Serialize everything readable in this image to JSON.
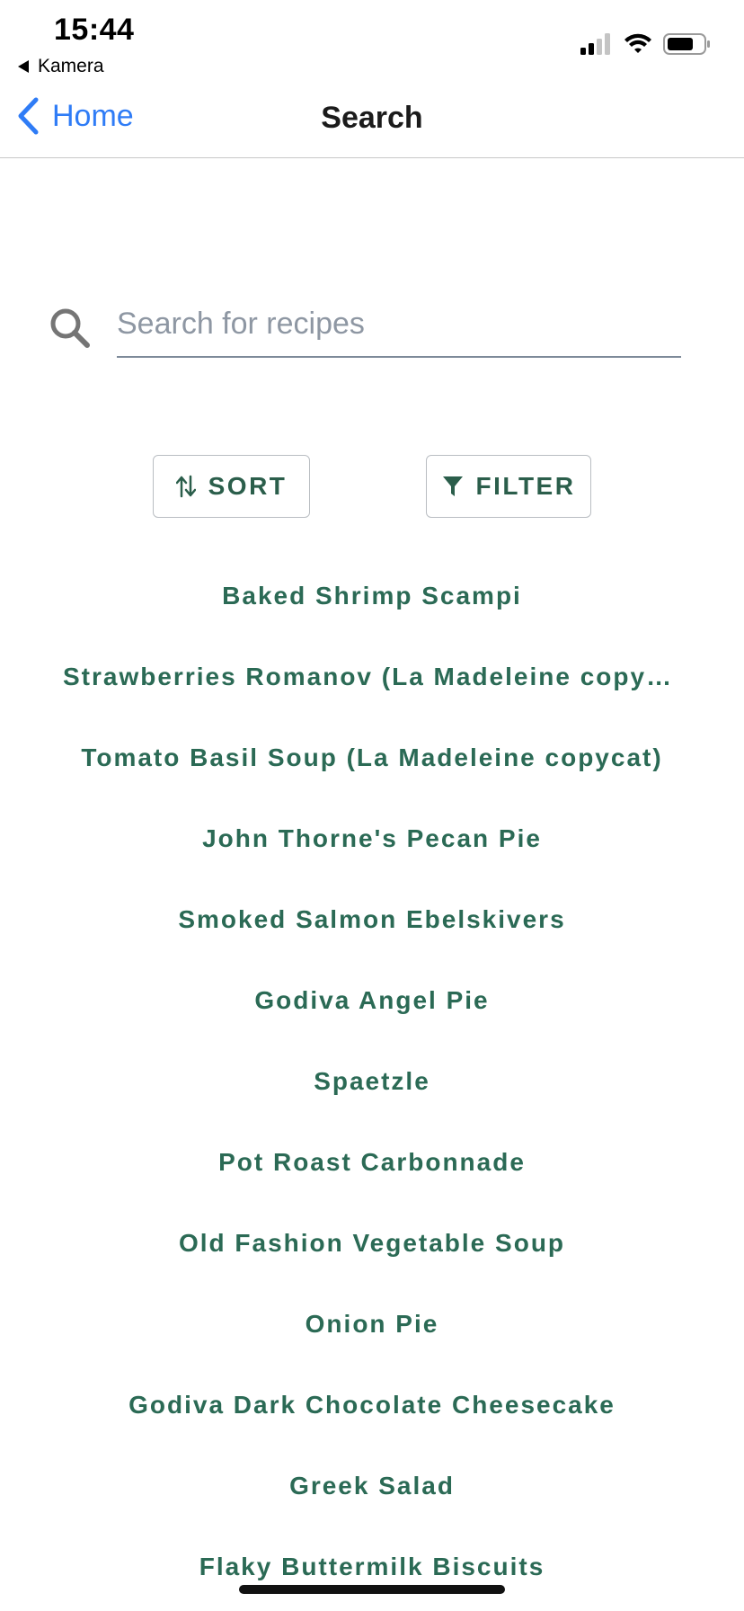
{
  "status_bar": {
    "time": "15:44",
    "back_app": "Kamera"
  },
  "navbar": {
    "back_label": "Home",
    "title": "Search"
  },
  "search": {
    "placeholder": "Search for recipes",
    "value": ""
  },
  "toolbar": {
    "sort_label": "SORT",
    "filter_label": "FILTER"
  },
  "recipes": [
    "Baked Shrimp Scampi",
    "Strawberries Romanov (La Madeleine copycat)",
    "Tomato Basil Soup (La Madeleine copycat)",
    "John Thorne's Pecan Pie",
    "Smoked Salmon Ebelskivers",
    "Godiva Angel Pie",
    "Spaetzle",
    "Pot Roast Carbonnade",
    "Old Fashion Vegetable Soup",
    "Onion Pie",
    "Godiva Dark Chocolate Cheesecake",
    "Greek Salad",
    "Flaky Buttermilk Biscuits"
  ],
  "colors": {
    "accent_link": "#2f7cf6",
    "recipe_text": "#2b6a55",
    "button_text": "#2b5e4b"
  },
  "icons": {
    "back": "chevron-left-icon",
    "search": "search-icon",
    "sort": "sort-arrows-icon",
    "filter": "funnel-icon"
  }
}
